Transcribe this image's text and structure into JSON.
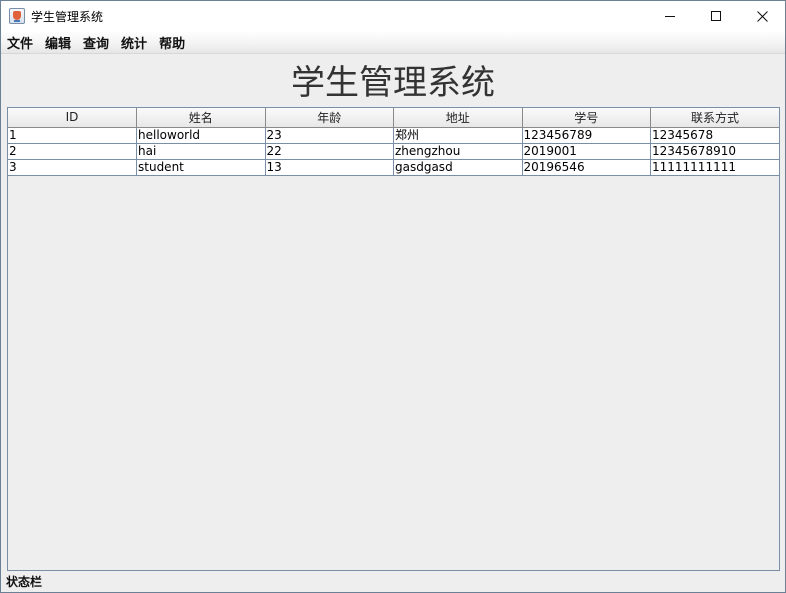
{
  "window": {
    "title": "学生管理系统"
  },
  "menu": [
    "文件",
    "编辑",
    "查询",
    "统计",
    "帮助"
  ],
  "heading": "学生管理系统",
  "table": {
    "columns": [
      "ID",
      "姓名",
      "年龄",
      "地址",
      "学号",
      "联系方式"
    ],
    "rows": [
      [
        "1",
        "helloworld",
        "23",
        "郑州",
        "123456789",
        "12345678"
      ],
      [
        "2",
        "hai",
        "22",
        "zhengzhou",
        "2019001",
        "12345678910"
      ],
      [
        "3",
        "student",
        "13",
        "gasdgasd",
        "20196546",
        "11111111111"
      ]
    ]
  },
  "status": "状态栏"
}
